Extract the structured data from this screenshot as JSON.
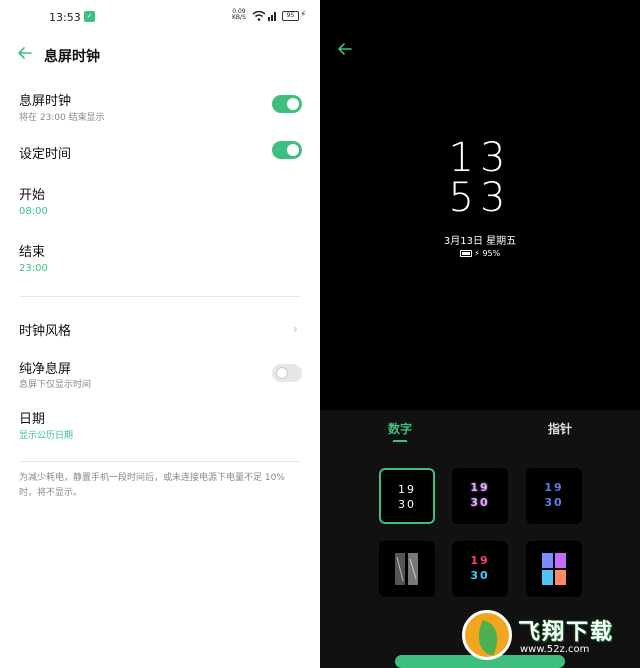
{
  "status_bar": {
    "time": "13:53",
    "net_speed_value": "0.09",
    "net_speed_unit": "KB/S",
    "battery": "95"
  },
  "settings": {
    "title": "息屏时钟",
    "aod": {
      "label": "息屏时钟",
      "sub": "将在 23:00 结束显示",
      "on": true
    },
    "set_time": {
      "label": "设定时间",
      "on": true
    },
    "start": {
      "label": "开始",
      "value": "08:00"
    },
    "end": {
      "label": "结束",
      "value": "23:00"
    },
    "clock_style": {
      "label": "时钟风格"
    },
    "pure": {
      "label": "纯净息屏",
      "sub": "息屏下仅显示时间",
      "on": false
    },
    "date": {
      "label": "日期",
      "value": "显示公历日期"
    },
    "note": "为减少耗电，静置手机一段时间后，或未连接电源下电量不足 10% 时，将不显示。"
  },
  "preview": {
    "hour": "13",
    "minute": "53",
    "date": "3月13日 星期五",
    "battery": "95%"
  },
  "style_picker": {
    "tab_digital": "数字",
    "tab_analog": "指针",
    "thumbs": [
      {
        "top": "19",
        "bottom": "30"
      },
      {
        "top": "19",
        "bottom": "30"
      },
      {
        "top": "19",
        "bottom": "30"
      },
      {
        "top": "19",
        "bottom": "30"
      }
    ]
  },
  "watermark": {
    "title": "飞翔下载",
    "url": "www.52z.com"
  },
  "colors": {
    "accent": "#3fbf7f",
    "dark_bg": "#000000",
    "picker_bg": "#111111"
  }
}
